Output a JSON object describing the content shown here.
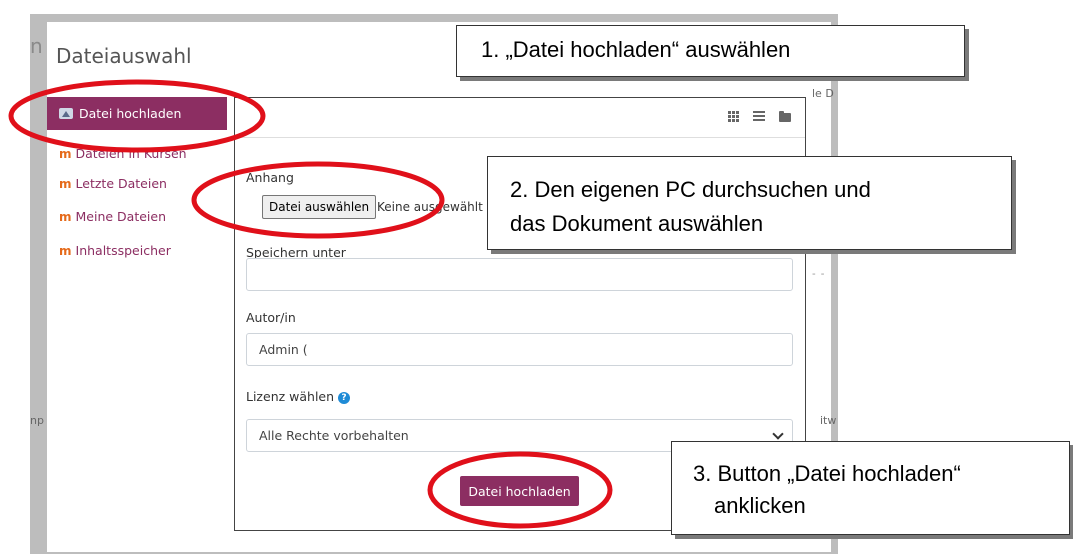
{
  "background": {
    "left_fragment": "n",
    "right_fragment_top": "le D",
    "left_fragment_mid": "np",
    "right_fragment_mid": "itw",
    "dash_fragment": "- -"
  },
  "dialog": {
    "title": "Dateiauswahl"
  },
  "sidebar": {
    "items": [
      {
        "label": "Datei hochladen",
        "icon": "upload-icon",
        "active": true
      },
      {
        "label": "Dateien in Kursen",
        "icon": "moodle-icon",
        "active": false
      },
      {
        "label": "Letzte Dateien",
        "icon": "moodle-icon",
        "active": false
      },
      {
        "label": "Meine Dateien",
        "icon": "moodle-icon",
        "active": false
      },
      {
        "label": "Inhaltsspeicher",
        "icon": "moodle-icon",
        "active": false
      }
    ]
  },
  "toolbar": {
    "icons": [
      "grid-view-icon",
      "list-view-icon",
      "folder-view-icon"
    ]
  },
  "form": {
    "attachment_label": "Anhang",
    "choose_file_button": "Datei auswählen",
    "no_file_text": "Keine ausgewählt",
    "save_as_label": "Speichern unter",
    "save_as_value": "",
    "author_label": "Autor/in",
    "author_value": "Admin (",
    "license_label": "Lizenz wählen",
    "license_value": "Alle Rechte vorbehalten",
    "submit_button": "Datei hochladen"
  },
  "callouts": {
    "step1": "1. „Datei hochladen“ auswählen",
    "step2_line1": "2. Den eigenen PC durchsuchen und",
    "step2_line2": "das Dokument auswählen",
    "step3_line1": "3. Button „Datei hochladen“",
    "step3_line2": "anklicken"
  },
  "colors": {
    "accent": "#8c2e62",
    "annotation_ring": "#e0101a",
    "moodle_icon": "#e56a1a",
    "frame": "#bdbdbd"
  }
}
